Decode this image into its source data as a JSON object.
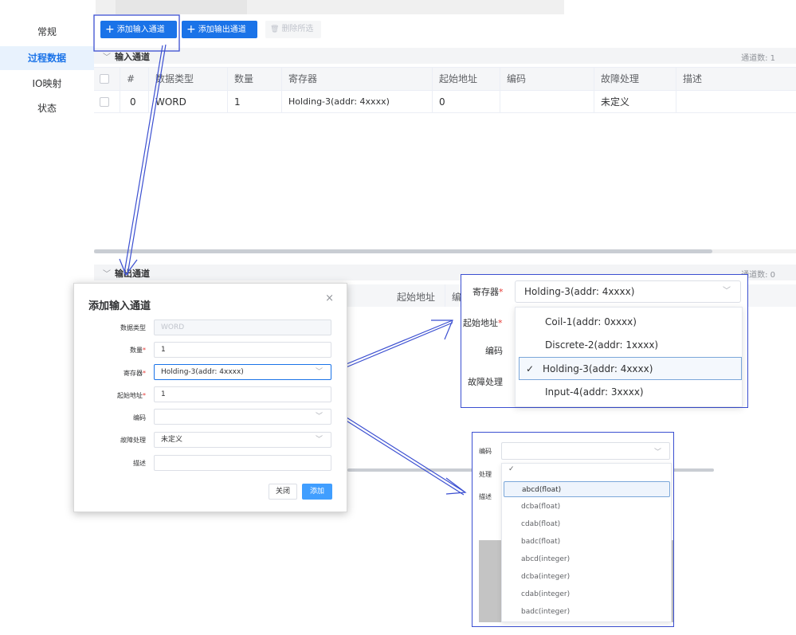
{
  "nav": {
    "items": [
      {
        "label": "常规",
        "active": false
      },
      {
        "label": "过程数据",
        "active": true
      },
      {
        "label": "IO映射",
        "active": false
      },
      {
        "label": "状态",
        "active": false
      }
    ]
  },
  "toolbar": {
    "add_input_label": "添加输入通道",
    "add_output_label": "添加输出通道",
    "delete_selected_label": "删除所选"
  },
  "input_section": {
    "title": "输入通道",
    "count_label": "通道数: 1",
    "columns": [
      "#",
      "数据类型",
      "数量",
      "寄存器",
      "起始地址",
      "编码",
      "故障处理",
      "描述"
    ],
    "rows": [
      {
        "index": "0",
        "data_type": "WORD",
        "quantity": "1",
        "register": "Holding-3(addr: 4xxxx)",
        "start_address": "0",
        "encoding": "",
        "fault_handling": "未定义",
        "description": ""
      }
    ]
  },
  "output_section": {
    "title": "输出通道",
    "count_label": "通道数: 0",
    "visible_columns": [
      "起始地址",
      "编"
    ]
  },
  "dialog": {
    "title": "添加输入通道",
    "close_icon": "×",
    "fields": {
      "data_type": {
        "label": "数据类型",
        "placeholder": "WORD"
      },
      "quantity": {
        "label": "数量",
        "value": "1"
      },
      "register": {
        "label": "寄存器",
        "value": "Holding-3(addr: 4xxxx)"
      },
      "start_address": {
        "label": "起始地址",
        "value": "1"
      },
      "encoding": {
        "label": "编码",
        "value": ""
      },
      "fault_handling": {
        "label": "故障处理",
        "value": "未定义"
      },
      "description": {
        "label": "描述",
        "value": ""
      }
    },
    "close_button": "关闭",
    "add_button": "添加"
  },
  "register_callout": {
    "labels": {
      "register": "寄存器",
      "start_address": "起始地址",
      "encoding": "编码",
      "fault_handling": "故障处理"
    },
    "selected_value": "Holding-3(addr: 4xxxx)",
    "options": [
      {
        "label": "Coil-1(addr: 0xxxx)",
        "selected": false
      },
      {
        "label": "Discrete-2(addr: 1xxxx)",
        "selected": false
      },
      {
        "label": "Holding-3(addr: 4xxxx)",
        "selected": true
      },
      {
        "label": "Input-4(addr: 3xxxx)",
        "selected": false
      }
    ]
  },
  "encoding_callout": {
    "labels": {
      "encoding": "编码",
      "fault_handling": "处理",
      "description": "描述"
    },
    "options": [
      "abcd(float)",
      "dcba(float)",
      "cdab(float)",
      "badc(float)",
      "abcd(integer)",
      "dcba(integer)",
      "cdab(integer)",
      "badc(integer)"
    ],
    "highlighted": "abcd(float)"
  },
  "colors": {
    "accent": "#1a73e8",
    "annotation": "#3b4fd1",
    "required": "#e53935"
  },
  "icons": {
    "plus": "plus-icon",
    "trash": "trash-icon",
    "chevron_down": "chevron-down-icon",
    "check": "check-icon",
    "close": "close-icon"
  }
}
